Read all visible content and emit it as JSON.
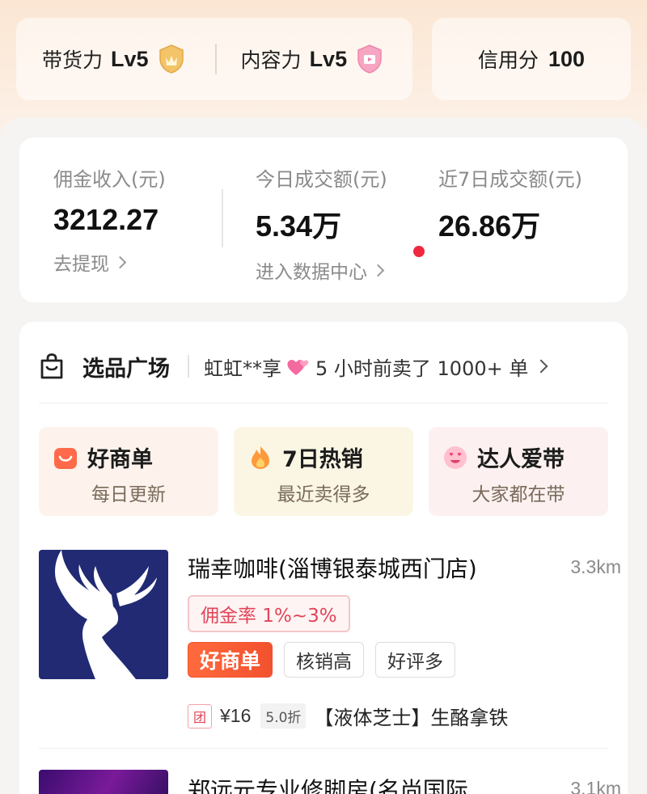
{
  "levels": {
    "sales_label": "带货力",
    "sales_value": "Lv5",
    "content_label": "内容力",
    "content_value": "Lv5",
    "credit_label": "信用分",
    "credit_value": "100"
  },
  "earnings": {
    "commission_title": "佣金收入(元)",
    "commission_value": "3212.27",
    "commission_link": "去提现",
    "today_title": "今日成交额(元)",
    "today_value": "5.34万",
    "today_link": "进入数据中心",
    "week_title": "近7日成交额(元)",
    "week_value": "26.86万"
  },
  "market": {
    "title": "选品广场",
    "ticker_user": "虹虹**享",
    "ticker_text": "5 小时前卖了 1000+ 单",
    "promos": [
      {
        "title": "好商单",
        "subtitle": "每日更新"
      },
      {
        "title": "7日热销",
        "subtitle": "最近卖得多"
      },
      {
        "title": "达人爱带",
        "subtitle": "大家都在带"
      }
    ]
  },
  "stores": [
    {
      "name": "瑞幸咖啡(淄博银泰城西门店)",
      "distance": "3.3km",
      "commission": "佣金率 1%~3%",
      "tags": [
        "好商单",
        "核销高",
        "好评多"
      ],
      "deal_badge": "团",
      "price": "¥16",
      "discount": "5.0折",
      "product": "【液体芝士】生酪拿铁"
    },
    {
      "name": "郑远元专业修脚房(名尚国际",
      "distance": "3.1km"
    }
  ],
  "colors": {
    "accent_red": "#f02840",
    "hot_tag": "#f2512e",
    "logo_blue": "#212a73"
  }
}
